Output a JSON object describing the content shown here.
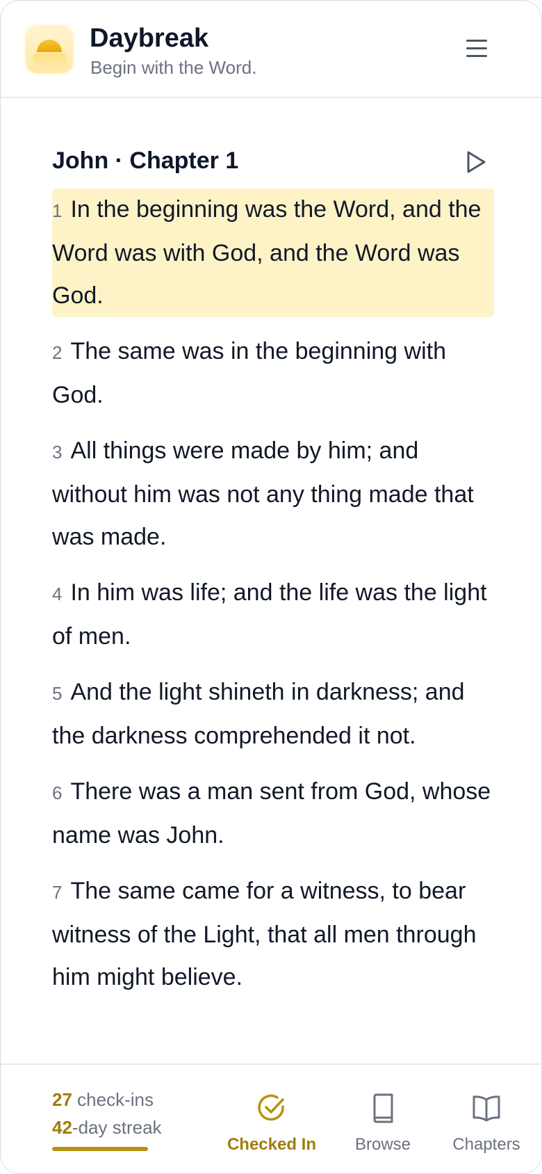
{
  "header": {
    "title": "Daybreak",
    "tagline": "Begin with the Word.",
    "logo_icon": "sunrise-icon",
    "menu_icon": "hamburger-menu-icon"
  },
  "reading": {
    "chapter_title": "John · Chapter 1",
    "play_icon": "play-icon",
    "verses": [
      {
        "num": "1",
        "text": "In the beginning was the Word, and the Word was with God, and the Word was God.",
        "highlighted": true
      },
      {
        "num": "2",
        "text": "The same was in the beginning with God."
      },
      {
        "num": "3",
        "text": "All things were made by him; and without him was not any thing made that was made."
      },
      {
        "num": "4",
        "text": "In him was life; and the life was the light of men."
      },
      {
        "num": "5",
        "text": "And the light shineth in darkness; and the darkness comprehended it not."
      },
      {
        "num": "6",
        "text": "There was a man sent from God, whose name was John."
      },
      {
        "num": "7",
        "text": "The same came for a witness, to bear witness of the Light, that all men through him might believe."
      }
    ],
    "highlight_color": "#fef3c7"
  },
  "bottom_bar": {
    "checkins_count": "27",
    "checkins_label": " check-ins",
    "streak_count": "42",
    "streak_label": "-day streak",
    "nav": [
      {
        "label": "Checked In",
        "icon": "check-circle-icon",
        "active": true
      },
      {
        "label": "Browse",
        "icon": "book-icon"
      },
      {
        "label": "Chapters",
        "icon": "open-book-icon"
      }
    ],
    "accent_color": "#a07d0c"
  }
}
